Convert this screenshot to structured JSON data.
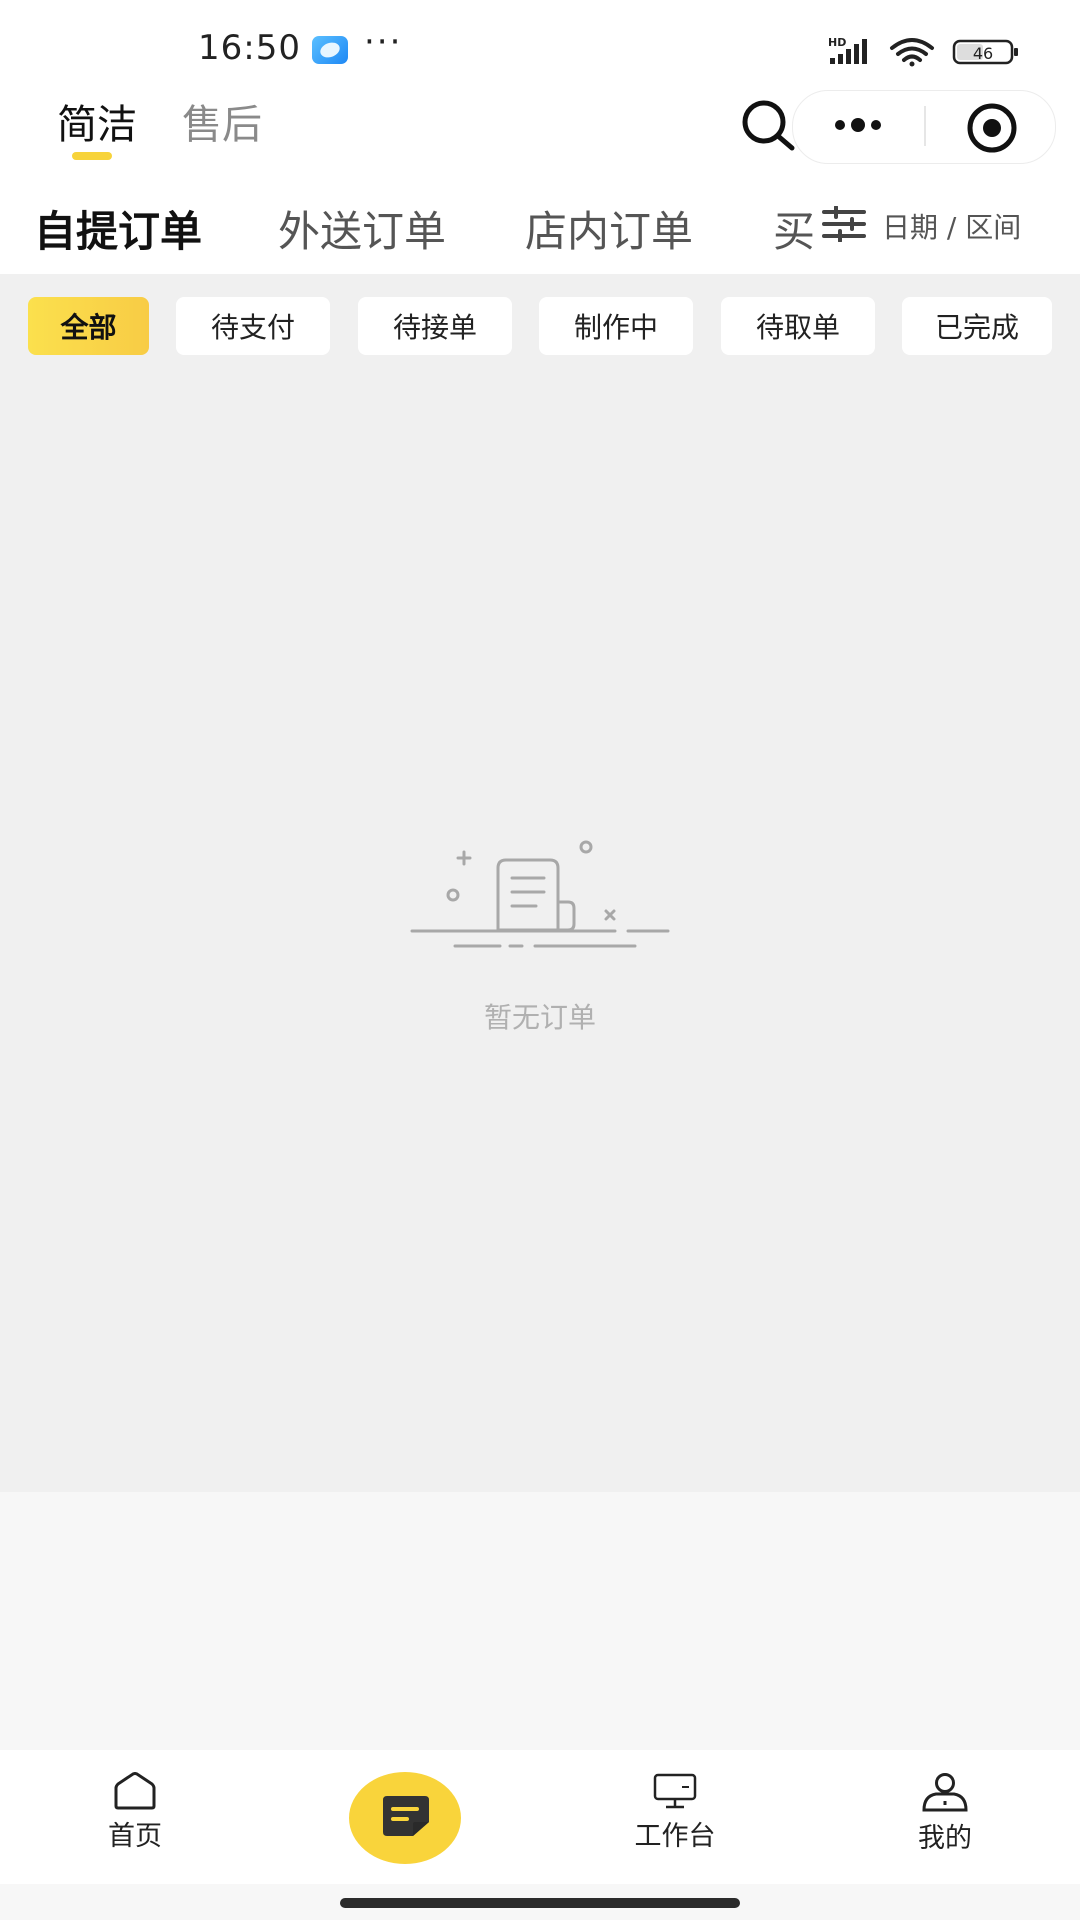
{
  "status_bar": {
    "time": "16:50",
    "battery": "46",
    "network_label": "HD",
    "icons": [
      "app-icon",
      "more-dots",
      "signal-icon",
      "wifi-icon",
      "battery-icon"
    ]
  },
  "top_tabs": [
    {
      "label": "简洁",
      "active": true
    },
    {
      "label": "售后",
      "active": false
    }
  ],
  "capsule": {
    "icons": [
      "search-icon",
      "more-icon",
      "target-icon"
    ]
  },
  "order_tabs": [
    {
      "label": "自提订单",
      "active": true
    },
    {
      "label": "外送订单",
      "active": false
    },
    {
      "label": "店内订单",
      "active": false
    },
    {
      "label": "买",
      "active": false
    }
  ],
  "date_range": {
    "label": "日期 / 区间",
    "icon": "filter-sliders-icon"
  },
  "status_chips": [
    {
      "label": "全部",
      "active": true
    },
    {
      "label": "待支付",
      "active": false
    },
    {
      "label": "待接单",
      "active": false
    },
    {
      "label": "制作中",
      "active": false
    },
    {
      "label": "待取单",
      "active": false
    },
    {
      "label": "已完成",
      "active": false
    }
  ],
  "empty_state": {
    "text": "暂无订单",
    "icon": "empty-order-illustration"
  },
  "bottom_nav": [
    {
      "label": "首页",
      "icon": "home-icon"
    },
    {
      "label": "",
      "icon": "order-chat-icon"
    },
    {
      "label": "工作台",
      "icon": "monitor-icon"
    },
    {
      "label": "我的",
      "icon": "user-icon"
    }
  ],
  "colors": {
    "accent_yellow": "#f9d43b",
    "content_bg": "#f0f0f0",
    "text_dark": "#111111",
    "text_muted": "#b0b0b0"
  }
}
